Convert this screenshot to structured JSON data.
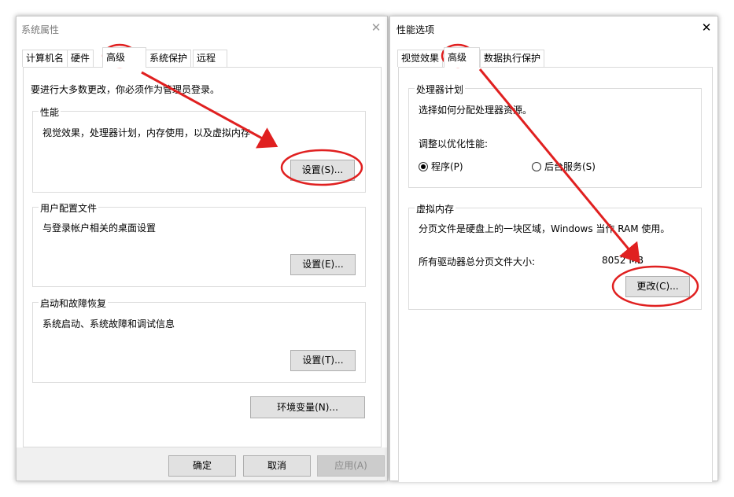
{
  "left_window": {
    "title": "系统属性",
    "close_glyph": "✕",
    "tabs": [
      "计算机名",
      "硬件",
      "高级",
      "系统保护",
      "远程"
    ],
    "active_tab": "高级",
    "admin_note": "要进行大多数更改，你必须作为管理员登录。",
    "performance": {
      "label": "性能",
      "text": "视觉效果，处理器计划，内存使用，以及虚拟内存",
      "button": "设置(S)..."
    },
    "user_profiles": {
      "label": "用户配置文件",
      "text": "与登录帐户相关的桌面设置",
      "button": "设置(E)..."
    },
    "startup_recovery": {
      "label": "启动和故障恢复",
      "text": "系统启动、系统故障和调试信息",
      "button": "设置(T)..."
    },
    "env_button": "环境变量(N)...",
    "ok_button": "确定",
    "cancel_button": "取消",
    "apply_button": "应用(A)"
  },
  "right_window": {
    "title": "性能选项",
    "close_glyph": "✕",
    "tabs": [
      "视觉效果",
      "高级",
      "数据执行保护"
    ],
    "active_tab": "高级",
    "processor_scheduling": {
      "label": "处理器计划",
      "text": "选择如何分配处理器资源。",
      "adjust_label": "调整以优化性能:",
      "option_programs": "程序(P)",
      "option_services": "后台服务(S)",
      "selected": "程序(P)"
    },
    "virtual_memory": {
      "label": "虚拟内存",
      "text": "分页文件是硬盘上的一块区域，Windows 当作 RAM 使用。",
      "total_label": "所有驱动器总分页文件大小:",
      "total_value": "8052 MB",
      "button": "更改(C)..."
    }
  },
  "annotation_colors": {
    "highlight": "#e02020"
  }
}
